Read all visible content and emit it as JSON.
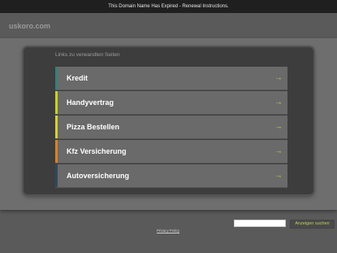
{
  "topbar": {
    "text": "This Domain Name Has Expired - Renewal Instructions."
  },
  "domain": {
    "name": "uskoro.com"
  },
  "panel": {
    "title": "Links zu verwandten Seiten"
  },
  "links": [
    {
      "label": "Kredit",
      "color": "#3a7d7a"
    },
    {
      "label": "Handyvertrag",
      "color": "#c8d12a"
    },
    {
      "label": "Pizza Bestellen",
      "color": "#d8cf3a"
    },
    {
      "label": "Kfz Versicherung",
      "color": "#d9812b"
    },
    {
      "label": "Autoversicherung",
      "color": "#2c4a5a"
    }
  ],
  "arrow_icon": "→",
  "search": {
    "value": "",
    "button_label": "Anzeigen suchen"
  },
  "footer": {
    "privacy_label": "Privacy Policy"
  },
  "colors": {
    "accent": "#b7d44a",
    "background": "#5a5a5a",
    "panel": "#3d3d3d"
  }
}
